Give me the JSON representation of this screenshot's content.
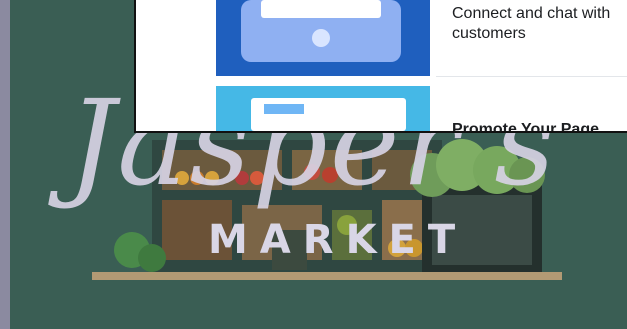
{
  "background": {
    "panel_color": "#3a5e54",
    "frame_color": "#8b8aa0"
  },
  "overlay": {
    "items": [
      {
        "text": "Connect and chat with customers",
        "icon": "tablet-chat-icon",
        "tile_color": "#1f5fbe"
      },
      {
        "text": "Promote Your Page",
        "icon": "promote-icon",
        "tile_color": "#45b8e6"
      }
    ]
  },
  "brand": {
    "script_name": "Jasper's",
    "subtitle": "MARKET"
  }
}
